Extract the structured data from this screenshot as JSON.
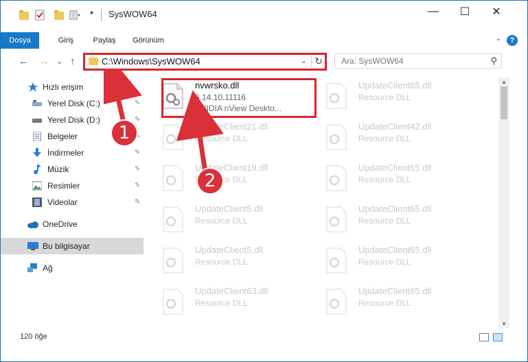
{
  "window": {
    "title": "SysWOW64",
    "minimize": "—",
    "maximize": "☐",
    "close": "✕"
  },
  "ribbon": {
    "tabs": [
      "Dosya",
      "Giriş",
      "Paylaş",
      "Görünüm"
    ],
    "help": "?"
  },
  "nav": {
    "back": "←",
    "forward": "→",
    "recent": "⌄",
    "up": "↑",
    "address": "C:\\Windows\\SysWOW64",
    "refresh": "↻",
    "search_placeholder": "Ara: SysWOW64"
  },
  "sidebar": {
    "items": [
      {
        "label": "Hızlı erişim",
        "icon": "star-icon"
      },
      {
        "label": "Yerel Disk (C:)",
        "icon": "drive-icon",
        "pinned": true
      },
      {
        "label": "Yerel Disk (D:)",
        "icon": "drive-icon",
        "pinned": true
      },
      {
        "label": "Belgeler",
        "icon": "documents-icon",
        "pinned": true
      },
      {
        "label": "İndirmeler",
        "icon": "download-icon",
        "pinned": true
      },
      {
        "label": "Müzik",
        "icon": "music-icon",
        "pinned": true
      },
      {
        "label": "Resimler",
        "icon": "pictures-icon",
        "pinned": true
      },
      {
        "label": "Videolar",
        "icon": "videos-icon",
        "pinned": true
      },
      {
        "label": "OneDrive",
        "icon": "cloud-icon"
      },
      {
        "label": "Bu bilgisayar",
        "icon": "computer-icon",
        "selected": true
      },
      {
        "label": "Ağ",
        "icon": "network-icon"
      }
    ],
    "pin_glyph": "📌"
  },
  "files": {
    "main": {
      "name": "nvwrsko.dll",
      "version": "6.14.10.11116",
      "description": "NVIDIA nView Deskto..."
    },
    "grid": [
      {
        "name": "UpdateClient65.dll",
        "type": "Resource DLL"
      },
      {
        "name": "UpdateClient21.dll",
        "type": "Resource DLL"
      },
      {
        "name": "UpdateClient42.dll",
        "type": "Resource DLL"
      },
      {
        "name": "UpdateClient19.dll",
        "type": "Resource DLL"
      },
      {
        "name": "UpdateClient65.dll",
        "type": "Resource DLL"
      },
      {
        "name": "UpdateClient5.dll",
        "type": "Resource DLL"
      },
      {
        "name": "UpdateClient65.dll",
        "type": "Resource DLL"
      },
      {
        "name": "UpdateClient5.dll",
        "type": "Resource DLL"
      },
      {
        "name": "UpdateClient65.dll",
        "type": "Resource DLL"
      },
      {
        "name": "UpdateClient63.dll",
        "type": "Resource DLL"
      },
      {
        "name": "UpdateClient65.dll",
        "type": "Resource DLL"
      }
    ]
  },
  "status": {
    "count": "120 öğe"
  },
  "annotations": {
    "step1": "1",
    "step2": "2"
  },
  "colors": {
    "accent": "#1979ca",
    "highlight": "#d9252a",
    "folder": "#f1c75b"
  }
}
